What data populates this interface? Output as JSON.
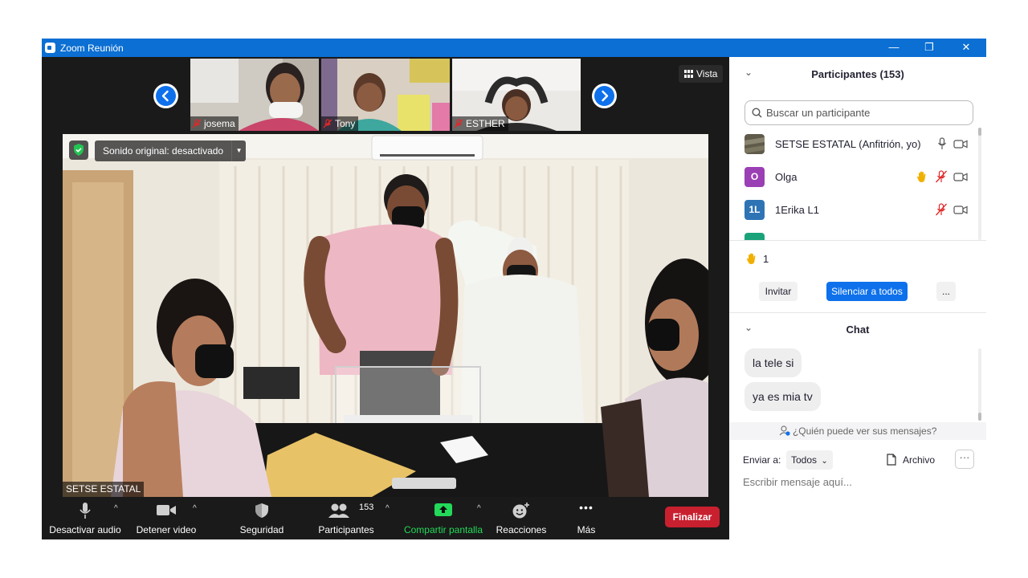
{
  "window": {
    "title": "Zoom Reunión",
    "minimize_glyph": "—",
    "restore_glyph": "❐",
    "close_glyph": "✕"
  },
  "stage": {
    "view_label": "Vista",
    "thumbnails": [
      {
        "name": "josema",
        "muted": true
      },
      {
        "name": "Tony",
        "muted": true
      },
      {
        "name": "ESTHER",
        "muted": true
      }
    ],
    "sound_label": "Sonido original: desactivado",
    "sound_caret": "▼",
    "main_speaker": "SETSE ESTATAL"
  },
  "toolbar": {
    "audio_label": "Desactivar audio",
    "video_label": "Detener video",
    "security_label": "Seguridad",
    "participants_label": "Participantes",
    "participants_count": "153",
    "share_label": "Compartir pantalla",
    "reactions_label": "Reacciones",
    "more_label": "Más",
    "more_glyph": "•••",
    "caret_glyph": "^",
    "end_label": "Finalizar"
  },
  "participants_panel": {
    "title": "Participantes (153)",
    "collapse_glyph": "⌄",
    "search_placeholder": "Buscar un participante",
    "participants": [
      {
        "name": "SETSE ESTATAL (Anfitrión, yo)",
        "initials": "",
        "avatar_color": "#6b6b55"
      },
      {
        "name": "Olga",
        "initials": "O",
        "avatar_color": "#9b3fb5"
      },
      {
        "name": "1Erika L1",
        "initials": "1L",
        "avatar_color": "#2e74b5"
      },
      {
        "name": "",
        "initials": "",
        "avatar_color": "#1aa37a"
      }
    ],
    "raised_hands": "1",
    "invite_label": "Invitar",
    "mute_all_label": "Silenciar a todos",
    "more_label": "..."
  },
  "chat": {
    "title": "Chat",
    "messages": [
      "la tele si",
      "ya es mia tv"
    ],
    "who_can_see": "¿Quién puede ver sus mensajes?",
    "send_to_label": "Enviar a:",
    "recipient": "Todos",
    "recipient_caret": "⌄",
    "file_label": "Archivo",
    "more_glyph": "···",
    "input_placeholder": "Escribir mensaje aquí..."
  },
  "colors": {
    "zoom_blue": "#0e71eb",
    "titlebar": "#0b6fd3",
    "end_red": "#c8202f",
    "share_green": "#23d959",
    "raised_hand": "#f0b000",
    "muted_red": "#e02828"
  }
}
